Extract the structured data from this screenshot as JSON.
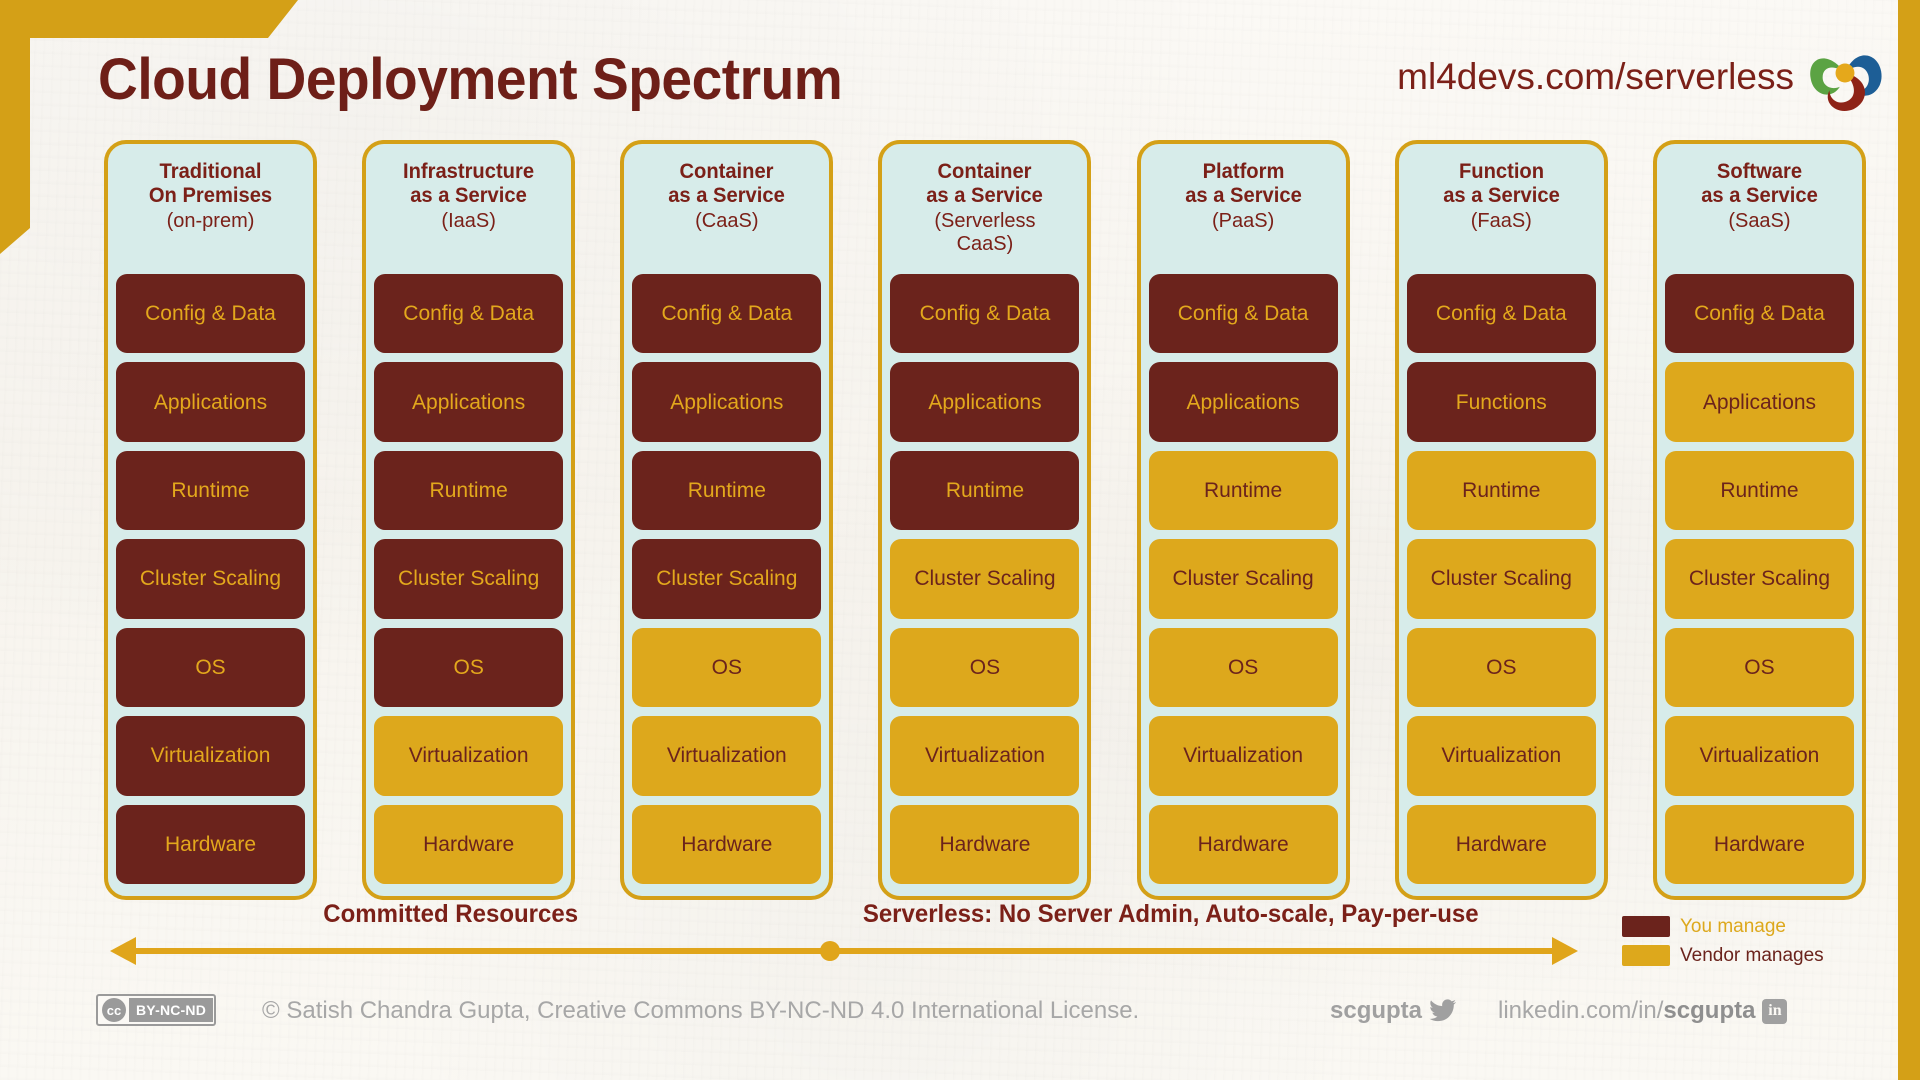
{
  "header": {
    "title": "Cloud Deployment Spectrum",
    "url": "ml4devs.com/serverless",
    "logo_icon": "ml4devs-pinwheel-logo-icon"
  },
  "colors": {
    "you_manage": "#6b231c",
    "vendor_manages": "#dda81c",
    "card_bg": "#d7ecea",
    "card_border": "#d4a017",
    "accent_maroon": "#7b2018",
    "page_bg": "#faf8f4"
  },
  "legend": {
    "items": [
      {
        "label": "You manage",
        "color": "#6b231c",
        "key": "you"
      },
      {
        "label": "Vendor manages",
        "color": "#dda81c",
        "key": "vendor"
      }
    ]
  },
  "spectrum": {
    "left_label": "Committed Resources",
    "right_label": "Serverless: No Server Admin, Auto-scale, Pay-per-use"
  },
  "columns": [
    {
      "title_line1": "Traditional",
      "title_line2": "On Premises",
      "subtitle_line1": "(on-prem)",
      "subtitle_line2": "",
      "layers": [
        {
          "label": "Config & Data",
          "owner": "you"
        },
        {
          "label": "Applications",
          "owner": "you"
        },
        {
          "label": "Runtime",
          "owner": "you"
        },
        {
          "label": "Cluster Scaling",
          "owner": "you"
        },
        {
          "label": "OS",
          "owner": "you"
        },
        {
          "label": "Virtualization",
          "owner": "you"
        },
        {
          "label": "Hardware",
          "owner": "you"
        }
      ]
    },
    {
      "title_line1": "Infrastructure",
      "title_line2": "as a Service",
      "subtitle_line1": "(IaaS)",
      "subtitle_line2": "",
      "layers": [
        {
          "label": "Config & Data",
          "owner": "you"
        },
        {
          "label": "Applications",
          "owner": "you"
        },
        {
          "label": "Runtime",
          "owner": "you"
        },
        {
          "label": "Cluster Scaling",
          "owner": "you"
        },
        {
          "label": "OS",
          "owner": "you"
        },
        {
          "label": "Virtualization",
          "owner": "vendor"
        },
        {
          "label": "Hardware",
          "owner": "vendor"
        }
      ]
    },
    {
      "title_line1": "Container",
      "title_line2": "as a Service",
      "subtitle_line1": "(CaaS)",
      "subtitle_line2": "",
      "layers": [
        {
          "label": "Config & Data",
          "owner": "you"
        },
        {
          "label": "Applications",
          "owner": "you"
        },
        {
          "label": "Runtime",
          "owner": "you"
        },
        {
          "label": "Cluster Scaling",
          "owner": "you"
        },
        {
          "label": "OS",
          "owner": "vendor"
        },
        {
          "label": "Virtualization",
          "owner": "vendor"
        },
        {
          "label": "Hardware",
          "owner": "vendor"
        }
      ]
    },
    {
      "title_line1": "Container",
      "title_line2": "as a Service",
      "subtitle_line1": "(Serverless",
      "subtitle_line2": "CaaS)",
      "layers": [
        {
          "label": "Config & Data",
          "owner": "you"
        },
        {
          "label": "Applications",
          "owner": "you"
        },
        {
          "label": "Runtime",
          "owner": "you"
        },
        {
          "label": "Cluster Scaling",
          "owner": "vendor"
        },
        {
          "label": "OS",
          "owner": "vendor"
        },
        {
          "label": "Virtualization",
          "owner": "vendor"
        },
        {
          "label": "Hardware",
          "owner": "vendor"
        }
      ]
    },
    {
      "title_line1": "Platform",
      "title_line2": "as a Service",
      "subtitle_line1": "(PaaS)",
      "subtitle_line2": "",
      "layers": [
        {
          "label": "Config & Data",
          "owner": "you"
        },
        {
          "label": "Applications",
          "owner": "you"
        },
        {
          "label": "Runtime",
          "owner": "vendor"
        },
        {
          "label": "Cluster Scaling",
          "owner": "vendor"
        },
        {
          "label": "OS",
          "owner": "vendor"
        },
        {
          "label": "Virtualization",
          "owner": "vendor"
        },
        {
          "label": "Hardware",
          "owner": "vendor"
        }
      ]
    },
    {
      "title_line1": "Function",
      "title_line2": "as a Service",
      "subtitle_line1": "(FaaS)",
      "subtitle_line2": "",
      "layers": [
        {
          "label": "Config & Data",
          "owner": "you"
        },
        {
          "label": "Functions",
          "owner": "you"
        },
        {
          "label": "Runtime",
          "owner": "vendor"
        },
        {
          "label": "Cluster Scaling",
          "owner": "vendor"
        },
        {
          "label": "OS",
          "owner": "vendor"
        },
        {
          "label": "Virtualization",
          "owner": "vendor"
        },
        {
          "label": "Hardware",
          "owner": "vendor"
        }
      ]
    },
    {
      "title_line1": "Software",
      "title_line2": "as a Service",
      "subtitle_line1": "(SaaS)",
      "subtitle_line2": "",
      "layers": [
        {
          "label": "Config & Data",
          "owner": "you"
        },
        {
          "label": "Applications",
          "owner": "vendor"
        },
        {
          "label": "Runtime",
          "owner": "vendor"
        },
        {
          "label": "Cluster Scaling",
          "owner": "vendor"
        },
        {
          "label": "OS",
          "owner": "vendor"
        },
        {
          "label": "Virtualization",
          "owner": "vendor"
        },
        {
          "label": "Hardware",
          "owner": "vendor"
        }
      ]
    }
  ],
  "footer": {
    "cc_mark": "cc",
    "cc_terms": "BY-NC-ND",
    "copyright": "© Satish Chandra Gupta, Creative Commons BY-NC-ND 4.0 International License.",
    "twitter_handle": "scgupta",
    "twitter_icon": "twitter-bird-icon",
    "linkedin_prefix": "linkedin.com/in/",
    "linkedin_handle": "scgupta",
    "linkedin_icon": "linkedin-icon"
  }
}
